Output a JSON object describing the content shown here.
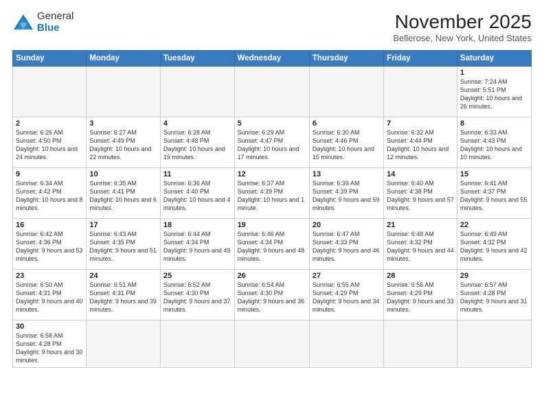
{
  "logo": {
    "line1": "General",
    "line2": "Blue"
  },
  "header": {
    "month": "November 2025",
    "location": "Bellerose, New York, United States"
  },
  "weekdays": [
    "Sunday",
    "Monday",
    "Tuesday",
    "Wednesday",
    "Thursday",
    "Friday",
    "Saturday"
  ],
  "weeks": [
    [
      {
        "day": "",
        "info": ""
      },
      {
        "day": "",
        "info": ""
      },
      {
        "day": "",
        "info": ""
      },
      {
        "day": "",
        "info": ""
      },
      {
        "day": "",
        "info": ""
      },
      {
        "day": "",
        "info": ""
      },
      {
        "day": "1",
        "info": "Sunrise: 7:24 AM\nSunset: 5:51 PM\nDaylight: 10 hours and 26 minutes."
      }
    ],
    [
      {
        "day": "2",
        "info": "Sunrise: 6:26 AM\nSunset: 4:50 PM\nDaylight: 10 hours and 24 minutes."
      },
      {
        "day": "3",
        "info": "Sunrise: 6:27 AM\nSunset: 4:49 PM\nDaylight: 10 hours and 22 minutes."
      },
      {
        "day": "4",
        "info": "Sunrise: 6:28 AM\nSunset: 4:48 PM\nDaylight: 10 hours and 19 minutes."
      },
      {
        "day": "5",
        "info": "Sunrise: 6:29 AM\nSunset: 4:47 PM\nDaylight: 10 hours and 17 minutes."
      },
      {
        "day": "6",
        "info": "Sunrise: 6:30 AM\nSunset: 4:46 PM\nDaylight: 10 hours and 15 minutes."
      },
      {
        "day": "7",
        "info": "Sunrise: 6:32 AM\nSunset: 4:44 PM\nDaylight: 10 hours and 12 minutes."
      },
      {
        "day": "8",
        "info": "Sunrise: 6:33 AM\nSunset: 4:43 PM\nDaylight: 10 hours and 10 minutes."
      }
    ],
    [
      {
        "day": "9",
        "info": "Sunrise: 6:34 AM\nSunset: 4:42 PM\nDaylight: 10 hours and 8 minutes."
      },
      {
        "day": "10",
        "info": "Sunrise: 6:35 AM\nSunset: 4:41 PM\nDaylight: 10 hours and 6 minutes."
      },
      {
        "day": "11",
        "info": "Sunrise: 6:36 AM\nSunset: 4:40 PM\nDaylight: 10 hours and 4 minutes."
      },
      {
        "day": "12",
        "info": "Sunrise: 6:37 AM\nSunset: 4:39 PM\nDaylight: 10 hours and 1 minute."
      },
      {
        "day": "13",
        "info": "Sunrise: 6:39 AM\nSunset: 4:39 PM\nDaylight: 9 hours and 59 minutes."
      },
      {
        "day": "14",
        "info": "Sunrise: 6:40 AM\nSunset: 4:38 PM\nDaylight: 9 hours and 57 minutes."
      },
      {
        "day": "15",
        "info": "Sunrise: 6:41 AM\nSunset: 4:37 PM\nDaylight: 9 hours and 55 minutes."
      }
    ],
    [
      {
        "day": "16",
        "info": "Sunrise: 6:42 AM\nSunset: 4:36 PM\nDaylight: 9 hours and 53 minutes."
      },
      {
        "day": "17",
        "info": "Sunrise: 6:43 AM\nSunset: 4:35 PM\nDaylight: 9 hours and 51 minutes."
      },
      {
        "day": "18",
        "info": "Sunrise: 6:44 AM\nSunset: 4:34 PM\nDaylight: 9 hours and 49 minutes."
      },
      {
        "day": "19",
        "info": "Sunrise: 6:46 AM\nSunset: 4:34 PM\nDaylight: 9 hours and 48 minutes."
      },
      {
        "day": "20",
        "info": "Sunrise: 6:47 AM\nSunset: 4:33 PM\nDaylight: 9 hours and 46 minutes."
      },
      {
        "day": "21",
        "info": "Sunrise: 6:48 AM\nSunset: 4:32 PM\nDaylight: 9 hours and 44 minutes."
      },
      {
        "day": "22",
        "info": "Sunrise: 6:49 AM\nSunset: 4:32 PM\nDaylight: 9 hours and 42 minutes."
      }
    ],
    [
      {
        "day": "23",
        "info": "Sunrise: 6:50 AM\nSunset: 4:31 PM\nDaylight: 9 hours and 40 minutes."
      },
      {
        "day": "24",
        "info": "Sunrise: 6:51 AM\nSunset: 4:31 PM\nDaylight: 9 hours and 39 minutes."
      },
      {
        "day": "25",
        "info": "Sunrise: 6:52 AM\nSunset: 4:30 PM\nDaylight: 9 hours and 37 minutes."
      },
      {
        "day": "26",
        "info": "Sunrise: 6:54 AM\nSunset: 4:30 PM\nDaylight: 9 hours and 36 minutes."
      },
      {
        "day": "27",
        "info": "Sunrise: 6:55 AM\nSunset: 4:29 PM\nDaylight: 9 hours and 34 minutes."
      },
      {
        "day": "28",
        "info": "Sunrise: 6:56 AM\nSunset: 4:29 PM\nDaylight: 9 hours and 33 minutes."
      },
      {
        "day": "29",
        "info": "Sunrise: 6:57 AM\nSunset: 4:28 PM\nDaylight: 9 hours and 31 minutes."
      }
    ],
    [
      {
        "day": "30",
        "info": "Sunrise: 6:58 AM\nSunset: 4:28 PM\nDaylight: 9 hours and 30 minutes."
      },
      {
        "day": "",
        "info": ""
      },
      {
        "day": "",
        "info": ""
      },
      {
        "day": "",
        "info": ""
      },
      {
        "day": "",
        "info": ""
      },
      {
        "day": "",
        "info": ""
      },
      {
        "day": "",
        "info": ""
      }
    ]
  ]
}
